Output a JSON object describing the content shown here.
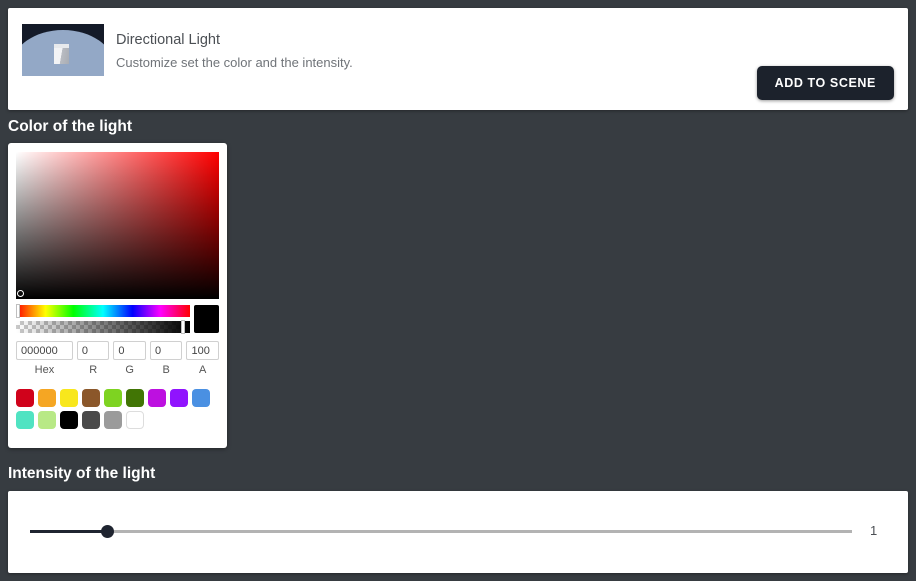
{
  "header": {
    "title": "Directional Light",
    "subtitle": "Customize set the color and the intensity.",
    "add_button_label": "ADD TO SCENE",
    "thumbnail_name": "directional-light-preview",
    "accent_button_color": "#1c222c"
  },
  "sections": {
    "color_label": "Color of the light",
    "intensity_label": "Intensity of the light"
  },
  "color_picker": {
    "selected_color_hex": "000000",
    "preview_color": "#000000",
    "fields": [
      {
        "key": "hex",
        "value": "000000",
        "label": "Hex"
      },
      {
        "key": "r",
        "value": "0",
        "label": "R"
      },
      {
        "key": "g",
        "value": "0",
        "label": "G"
      },
      {
        "key": "b",
        "value": "0",
        "label": "B"
      },
      {
        "key": "a",
        "value": "100",
        "label": "A"
      }
    ],
    "swatches": [
      {
        "name": "crimson",
        "color": "#d0021b"
      },
      {
        "name": "orange",
        "color": "#f5a623"
      },
      {
        "name": "yellow",
        "color": "#f8e71c"
      },
      {
        "name": "brown",
        "color": "#8b572a"
      },
      {
        "name": "lime-green",
        "color": "#7ed321"
      },
      {
        "name": "dark-green",
        "color": "#417505"
      },
      {
        "name": "magenta",
        "color": "#bd10e0"
      },
      {
        "name": "purple",
        "color": "#9013fe"
      },
      {
        "name": "blue",
        "color": "#4a90e2"
      },
      {
        "name": "turquoise",
        "color": "#50e3c2"
      },
      {
        "name": "light-green",
        "color": "#b8e986"
      },
      {
        "name": "black",
        "color": "#000000"
      },
      {
        "name": "dark-gray",
        "color": "#4a4a4a"
      },
      {
        "name": "gray",
        "color": "#9b9b9b"
      },
      {
        "name": "white",
        "color": "#ffffff"
      }
    ]
  },
  "intensity": {
    "value": "1",
    "min": "0",
    "max": "10",
    "percent": 9.4
  }
}
